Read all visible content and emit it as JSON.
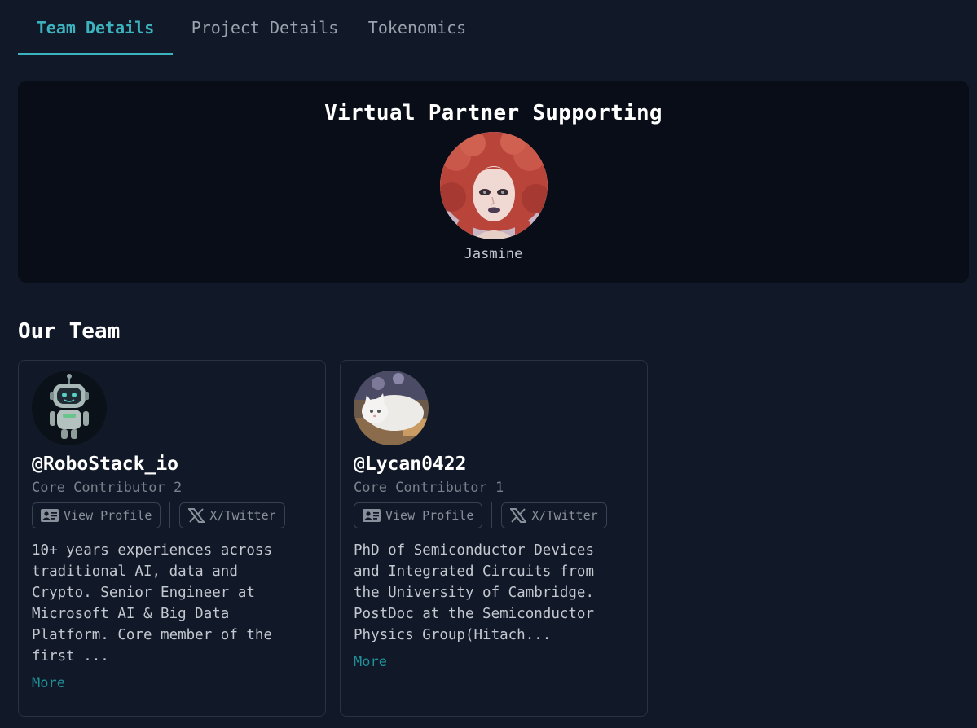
{
  "tabs": [
    {
      "label": "Team Details",
      "active": true
    },
    {
      "label": "Project Details",
      "active": false
    },
    {
      "label": "Tokenomics",
      "active": false
    }
  ],
  "partner": {
    "title": "Virtual Partner Supporting",
    "name": "Jasmine"
  },
  "team": {
    "heading": "Our Team",
    "members": [
      {
        "handle": "@RoboStack_io",
        "role": "Core Contributor 2",
        "profile_label": "View Profile",
        "twitter_label": "X/Twitter",
        "description": "10+ years experiences across\ntraditional AI, data and\nCrypto. Senior Engineer at\nMicrosoft AI & Big Data\nPlatform. Core member of the\nfirst ...",
        "more_label": "More",
        "avatar_icon": "robot-avatar"
      },
      {
        "handle": "@Lycan0422",
        "role": "Core Contributor 1",
        "profile_label": "View Profile",
        "twitter_label": "X/Twitter",
        "description": "PhD of Semiconductor Devices\nand Integrated Circuits from\nthe University of Cambridge.\nPostDoc at the Semiconductor\nPhysics Group(Hitach...",
        "more_label": "More",
        "avatar_icon": "cat-avatar"
      }
    ]
  },
  "colors": {
    "background": "#111827",
    "accent": "#3db2bf",
    "more_link": "#1f8f98"
  }
}
